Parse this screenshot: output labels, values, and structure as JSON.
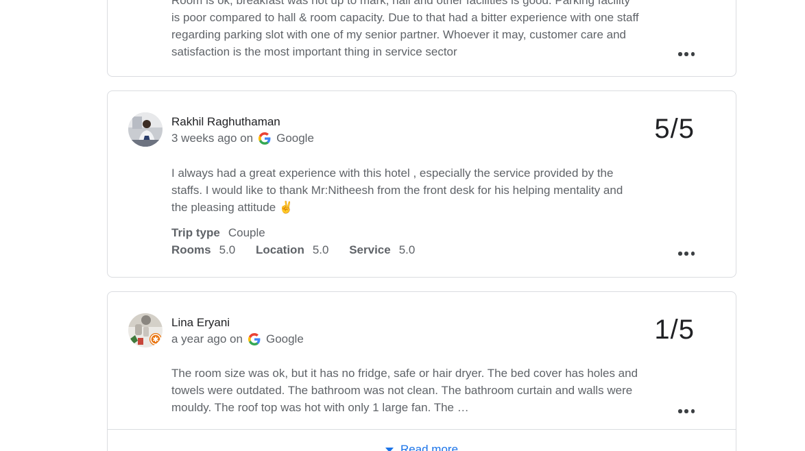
{
  "reviews": [
    {
      "text_lines": [
        "Room is ok, breakfast was not up to mark, hall and other facilities is good. Parking facility",
        "is poor compared to hall & room capacity. Due to that had a bitter experience with one staff",
        "regarding parking slot with one of my senior partner. Whoever it may, customer care and",
        "satisfaction is the most important thing in service sector"
      ]
    },
    {
      "author": "Rakhil Raghuthaman",
      "time": "3 weeks ago on",
      "source": "Google",
      "score": "5/5",
      "text_lines": [
        "I always had a great experience with this hotel , especially the service provided by the",
        "staffs. I would like to thank Mr:Nitheesh from the front desk for his helping mentality and",
        "the pleasing attitude ✌"
      ],
      "trip_type_label": "Trip type",
      "trip_type_value": "Couple",
      "rooms_label": "Rooms",
      "rooms_value": "5.0",
      "location_label": "Location",
      "location_value": "5.0",
      "service_label": "Service",
      "service_value": "5.0"
    },
    {
      "author": "Lina Eryani",
      "time": "a year ago on",
      "source": "Google",
      "score": "1/5",
      "text_lines": [
        "The room size was ok, but it has no fridge, safe or hair dryer. The bed cover has holes and",
        "towels were outdated. The bathroom was not clean. The bathroom curtain and walls were",
        "mouldy. The roof top was hot with only 1 large fan. The …"
      ],
      "read_more": "Read more"
    }
  ],
  "icons": {
    "more": "more-horizontal-icon",
    "google": "google-g-icon",
    "caret": "caret-down-icon"
  },
  "colors": {
    "link": "#1a73e8",
    "text": "#5f6368",
    "border": "#dadce0"
  }
}
